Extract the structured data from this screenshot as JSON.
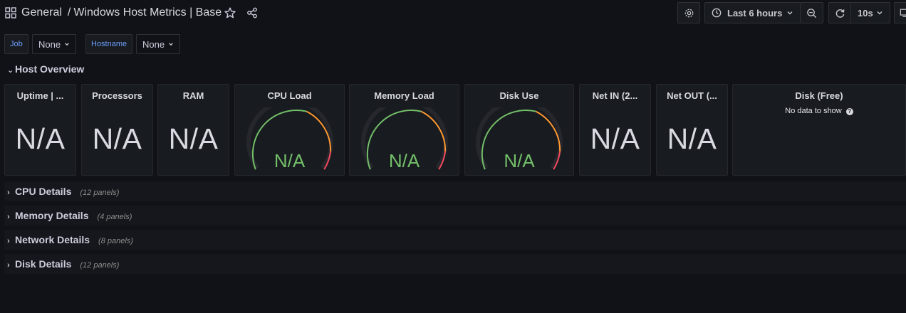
{
  "breadcrumb": {
    "folder": "General",
    "separator": "/",
    "dashboard": "Windows Host Metrics | Base"
  },
  "toolbar": {
    "time_range": "Last 6 hours",
    "refresh_interval": "10s"
  },
  "variables": [
    {
      "label": "Job",
      "value": "None"
    },
    {
      "label": "Hostname",
      "value": "None"
    }
  ],
  "rows": {
    "host_overview": {
      "title": "Host Overview"
    },
    "cpu": {
      "title": "CPU Details",
      "count": "(12 panels)"
    },
    "memory": {
      "title": "Memory Details",
      "count": "(4 panels)"
    },
    "network": {
      "title": "Network Details",
      "count": "(8 panels)"
    },
    "disk": {
      "title": "Disk Details",
      "count": "(12 panels)"
    }
  },
  "panels": {
    "uptime": {
      "title": "Uptime | ...",
      "value": "N/A"
    },
    "processors": {
      "title": "Processors",
      "value": "N/A"
    },
    "ram": {
      "title": "RAM",
      "value": "N/A"
    },
    "cpu_load": {
      "title": "CPU Load",
      "value": "N/A"
    },
    "memory_load": {
      "title": "Memory Load",
      "value": "N/A"
    },
    "disk_use": {
      "title": "Disk Use",
      "value": "N/A"
    },
    "net_in": {
      "title": "Net IN (2...",
      "value": "N/A"
    },
    "net_out": {
      "title": "Net OUT (...",
      "value": "N/A"
    },
    "disk_free": {
      "title": "Disk (Free)",
      "message": "No data to show"
    }
  },
  "colors": {
    "background": "#111217",
    "panel": "#181b1f",
    "value_ok": "#73bf69",
    "threshold_warn": "#ff9830",
    "threshold_crit": "#f2495c",
    "variable_label": "#6e9fff"
  },
  "icons": [
    "apps-icon",
    "star-icon",
    "share-icon",
    "gear-icon",
    "clock-icon",
    "chevron-down-icon",
    "zoom-out-icon",
    "refresh-icon",
    "tv-icon",
    "question-circle-icon"
  ]
}
